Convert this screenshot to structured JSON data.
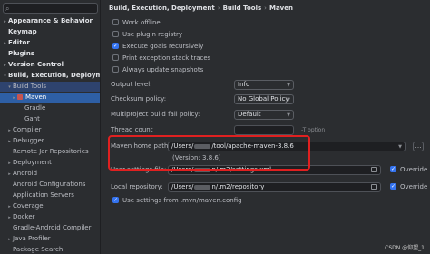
{
  "sidebar": {
    "search_icon": "search-icon",
    "items": [
      {
        "label": "Appearance & Behavior",
        "chev": "›",
        "bold": true
      },
      {
        "label": "Keymap",
        "bold": true
      },
      {
        "label": "Editor",
        "chev": "›",
        "bold": true
      },
      {
        "label": "Plugins",
        "bold": true
      },
      {
        "label": "Version Control",
        "chev": "›",
        "bold": true
      },
      {
        "label": "Build, Execution, Deployment",
        "chev": "⌄",
        "bold": true
      },
      {
        "label": "Build Tools",
        "chev": "⌄"
      },
      {
        "label": "Maven",
        "chev": "›"
      },
      {
        "label": "Gradle"
      },
      {
        "label": "Gant"
      },
      {
        "label": "Compiler",
        "chev": "›"
      },
      {
        "label": "Debugger",
        "chev": "›"
      },
      {
        "label": "Remote Jar Repositories"
      },
      {
        "label": "Deployment",
        "chev": "›"
      },
      {
        "label": "Android",
        "chev": "›"
      },
      {
        "label": "Android Configurations"
      },
      {
        "label": "Application Servers"
      },
      {
        "label": "Coverage",
        "chev": "›"
      },
      {
        "label": "Docker",
        "chev": "›"
      },
      {
        "label": "Gradle-Android Compiler"
      },
      {
        "label": "Java Profiler",
        "chev": "›"
      },
      {
        "label": "Package Search"
      }
    ]
  },
  "breadcrumb": [
    "Build, Execution, Deployment",
    "Build Tools",
    "Maven"
  ],
  "checkboxes": [
    {
      "label": "Work offline",
      "checked": false
    },
    {
      "label": "Use plugin registry",
      "checked": false
    },
    {
      "label": "Execute goals recursively",
      "checked": true
    },
    {
      "label": "Print exception stack traces",
      "checked": false
    },
    {
      "label": "Always update snapshots",
      "checked": false
    }
  ],
  "output_level": {
    "label": "Output level:",
    "value": "Info"
  },
  "checksum_policy": {
    "label": "Checksum policy:",
    "value": "No Global Policy"
  },
  "multiproject": {
    "label": "Multiproject build fail policy:",
    "value": "Default"
  },
  "thread_count": {
    "label": "Thread count",
    "value": "",
    "hint": "-T option"
  },
  "maven_home": {
    "label": "Maven home path:",
    "prefix": "/Users/",
    "suffix": "/tool/apache-maven-3.8.6",
    "version": "(Version: 3.8.6)"
  },
  "user_settings": {
    "label": "User settings file:",
    "prefix": "/Users/",
    "suffix": "n/.m2/settings.xml",
    "override": "Override"
  },
  "local_repo": {
    "label": "Local repository:",
    "prefix": "/Users/",
    "suffix": "n/.m2/repository",
    "override": "Override"
  },
  "use_settings": {
    "label": "Use settings from .mvn/maven.config",
    "checked": true
  },
  "watermark": "CSDN @仰望_1",
  "colors": {
    "highlight": "#e02020",
    "accent": "#3574f0",
    "selection": "#2e5fa5"
  }
}
